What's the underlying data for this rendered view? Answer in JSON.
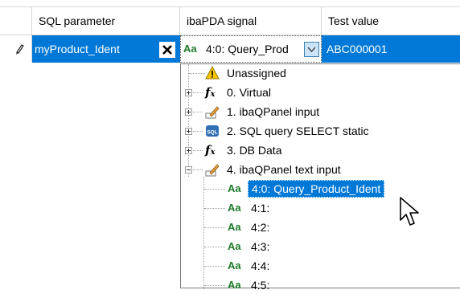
{
  "grid": {
    "columns": [
      {
        "label": "SQL parameter"
      },
      {
        "label": "ibaPDA signal"
      },
      {
        "label": "Test value"
      }
    ],
    "row": {
      "parameter": "myProduct_Ident",
      "signal": "4:0: Query_Prod",
      "signal_icon": "Aa",
      "test_value": "ABC000001"
    }
  },
  "tree": {
    "items": [
      {
        "label": "Unassigned",
        "icon": "warning-icon"
      },
      {
        "label": "0. Virtual",
        "icon": "fx-icon"
      },
      {
        "label": "1. ibaQPanel input",
        "icon": "pencil-icon"
      },
      {
        "label": "2. SQL query SELECT static",
        "icon": "sql-icon"
      },
      {
        "label": "3. DB Data",
        "icon": "fx-icon"
      },
      {
        "label": "4. ibaQPanel text input",
        "icon": "pencil-icon"
      }
    ],
    "children": [
      {
        "label": "4:0: Query_Product_Ident",
        "selected": true
      },
      {
        "label": "4:1:"
      },
      {
        "label": "4:2:"
      },
      {
        "label": "4:3:"
      },
      {
        "label": "4:4:"
      },
      {
        "label": "4:5:"
      }
    ],
    "child_icon_text": "Aa"
  },
  "colors": {
    "selection": "#0078d7",
    "grid_line": "#d6d6d6",
    "text_icon_green": "#1e7a2a"
  }
}
